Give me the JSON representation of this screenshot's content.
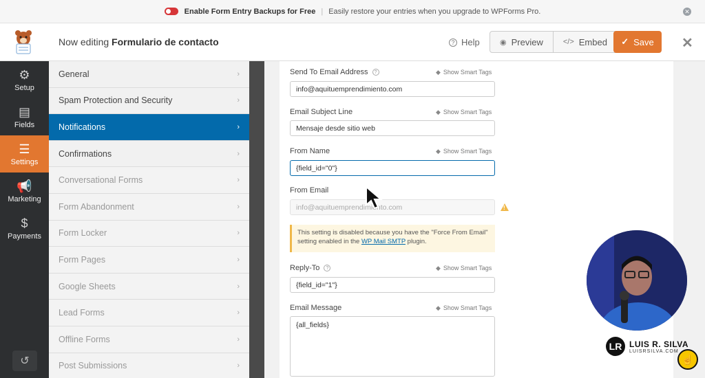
{
  "notice": {
    "title": "Enable Form Entry Backups for Free",
    "message": "Easily restore your entries when you upgrade to WPForms Pro.",
    "close_glyph": "✕"
  },
  "header": {
    "editing_prefix": "Now editing",
    "form_name": "Formulario de contacto",
    "help_label": "Help",
    "preview_label": "Preview",
    "embed_label": "Embed",
    "save_label": "Save",
    "close_glyph": "✕"
  },
  "iconbar": {
    "items": [
      {
        "label": "Setup",
        "icon": "gear-icon",
        "glyph": "⚙"
      },
      {
        "label": "Fields",
        "icon": "fields-icon",
        "glyph": "▤"
      },
      {
        "label": "Settings",
        "icon": "sliders-icon",
        "glyph": "☰"
      },
      {
        "label": "Marketing",
        "icon": "megaphone-icon",
        "glyph": "📢"
      },
      {
        "label": "Payments",
        "icon": "dollar-icon",
        "glyph": "$"
      }
    ],
    "revisions_glyph": "↺"
  },
  "settings_panels": {
    "items": [
      {
        "label": "General"
      },
      {
        "label": "Spam Protection and Security"
      },
      {
        "label": "Notifications"
      },
      {
        "label": "Confirmations"
      },
      {
        "label": "Conversational Forms"
      },
      {
        "label": "Form Abandonment"
      },
      {
        "label": "Form Locker"
      },
      {
        "label": "Form Pages"
      },
      {
        "label": "Google Sheets"
      },
      {
        "label": "Lead Forms"
      },
      {
        "label": "Offline Forms"
      },
      {
        "label": "Post Submissions"
      }
    ],
    "chevron": "›"
  },
  "notification": {
    "smart_tags_label": "Show Smart Tags",
    "send_to": {
      "label": "Send To Email Address",
      "value": "info@aquituemprendimiento.com"
    },
    "subject": {
      "label": "Email Subject Line",
      "value": "Mensaje desde sitio web"
    },
    "from_name": {
      "label": "From Name",
      "value": "{field_id=\"0\"}"
    },
    "from_email": {
      "label": "From Email",
      "value": "info@aquituemprendimiento.com"
    },
    "from_email_notice_1": "This setting is disabled because you have the \"Force From Email\" setting enabled in the ",
    "from_email_notice_link": "WP Mail SMTP",
    "from_email_notice_2": " plugin.",
    "reply_to": {
      "label": "Reply-To",
      "value": "{field_id=\"1\"}"
    },
    "message": {
      "label": "Email Message",
      "value": "{all_fields}"
    }
  },
  "overlay": {
    "brand_name": "LUIS R. SILVA",
    "brand_site": "LUISRSILVA.COM",
    "brand_initials": "LR"
  },
  "colors": {
    "accent": "#e27730",
    "active_blue": "#036aab",
    "sidebar_dark": "#2d2f31"
  }
}
